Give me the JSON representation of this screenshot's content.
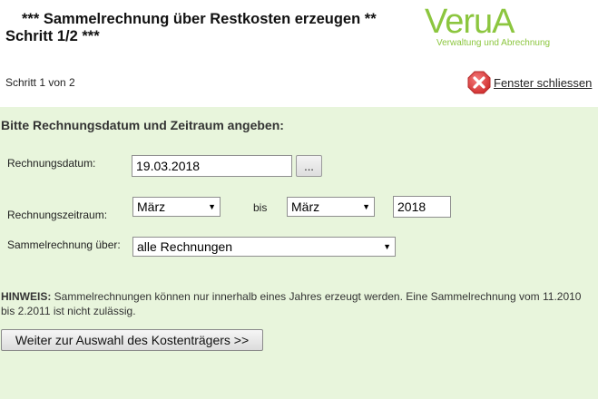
{
  "header": {
    "title_line1": "*** Sammelrechnung über Restkosten erzeugen **",
    "title_line2": "Schritt 1/2 ***",
    "step_text": "Schritt 1 von 2",
    "close_label": "Fenster schliessen"
  },
  "logo": {
    "main": "VeruA",
    "tagline": "Verwaltung und Abrechnung"
  },
  "form": {
    "intro": "Bitte Rechnungsdatum und Zeitraum angeben:",
    "datum_label": "Rechnungsdatum:",
    "datum_value": "19.03.2018",
    "datum_picker_label": "...",
    "zeitraum_label": "Rechnungszeitraum:",
    "month_from": "März",
    "bis_label": "bis",
    "month_to": "März",
    "year_value": "2018",
    "sammel_label": "Sammelrechnung über:",
    "sammel_value": "alle Rechnungen"
  },
  "hint": {
    "prefix": "HINWEIS:",
    "text": " Sammelrechnungen können nur innerhalb eines Jahres erzeugt werden. Eine Sammelrechnung vom 11.2010 bis 2.2011 ist nicht zulässig."
  },
  "actions": {
    "next_label": "Weiter zur Auswahl des Kostenträgers >>"
  },
  "colors": {
    "panel_bg": "#e8f5dc",
    "logo_green": "#8cc63f",
    "close_red": "#e04848"
  }
}
